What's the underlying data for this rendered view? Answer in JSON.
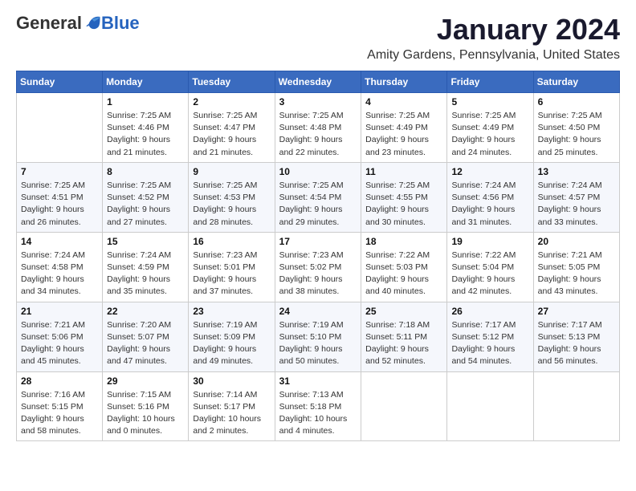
{
  "logo": {
    "general": "General",
    "blue": "Blue"
  },
  "header": {
    "month": "January 2024",
    "location": "Amity Gardens, Pennsylvania, United States"
  },
  "weekdays": [
    "Sunday",
    "Monday",
    "Tuesday",
    "Wednesday",
    "Thursday",
    "Friday",
    "Saturday"
  ],
  "weeks": [
    [
      {
        "day": "",
        "sunrise": "",
        "sunset": "",
        "daylight": ""
      },
      {
        "day": "1",
        "sunrise": "Sunrise: 7:25 AM",
        "sunset": "Sunset: 4:46 PM",
        "daylight": "Daylight: 9 hours and 21 minutes."
      },
      {
        "day": "2",
        "sunrise": "Sunrise: 7:25 AM",
        "sunset": "Sunset: 4:47 PM",
        "daylight": "Daylight: 9 hours and 21 minutes."
      },
      {
        "day": "3",
        "sunrise": "Sunrise: 7:25 AM",
        "sunset": "Sunset: 4:48 PM",
        "daylight": "Daylight: 9 hours and 22 minutes."
      },
      {
        "day": "4",
        "sunrise": "Sunrise: 7:25 AM",
        "sunset": "Sunset: 4:49 PM",
        "daylight": "Daylight: 9 hours and 23 minutes."
      },
      {
        "day": "5",
        "sunrise": "Sunrise: 7:25 AM",
        "sunset": "Sunset: 4:49 PM",
        "daylight": "Daylight: 9 hours and 24 minutes."
      },
      {
        "day": "6",
        "sunrise": "Sunrise: 7:25 AM",
        "sunset": "Sunset: 4:50 PM",
        "daylight": "Daylight: 9 hours and 25 minutes."
      }
    ],
    [
      {
        "day": "7",
        "sunrise": "Sunrise: 7:25 AM",
        "sunset": "Sunset: 4:51 PM",
        "daylight": "Daylight: 9 hours and 26 minutes."
      },
      {
        "day": "8",
        "sunrise": "Sunrise: 7:25 AM",
        "sunset": "Sunset: 4:52 PM",
        "daylight": "Daylight: 9 hours and 27 minutes."
      },
      {
        "day": "9",
        "sunrise": "Sunrise: 7:25 AM",
        "sunset": "Sunset: 4:53 PM",
        "daylight": "Daylight: 9 hours and 28 minutes."
      },
      {
        "day": "10",
        "sunrise": "Sunrise: 7:25 AM",
        "sunset": "Sunset: 4:54 PM",
        "daylight": "Daylight: 9 hours and 29 minutes."
      },
      {
        "day": "11",
        "sunrise": "Sunrise: 7:25 AM",
        "sunset": "Sunset: 4:55 PM",
        "daylight": "Daylight: 9 hours and 30 minutes."
      },
      {
        "day": "12",
        "sunrise": "Sunrise: 7:24 AM",
        "sunset": "Sunset: 4:56 PM",
        "daylight": "Daylight: 9 hours and 31 minutes."
      },
      {
        "day": "13",
        "sunrise": "Sunrise: 7:24 AM",
        "sunset": "Sunset: 4:57 PM",
        "daylight": "Daylight: 9 hours and 33 minutes."
      }
    ],
    [
      {
        "day": "14",
        "sunrise": "Sunrise: 7:24 AM",
        "sunset": "Sunset: 4:58 PM",
        "daylight": "Daylight: 9 hours and 34 minutes."
      },
      {
        "day": "15",
        "sunrise": "Sunrise: 7:24 AM",
        "sunset": "Sunset: 4:59 PM",
        "daylight": "Daylight: 9 hours and 35 minutes."
      },
      {
        "day": "16",
        "sunrise": "Sunrise: 7:23 AM",
        "sunset": "Sunset: 5:01 PM",
        "daylight": "Daylight: 9 hours and 37 minutes."
      },
      {
        "day": "17",
        "sunrise": "Sunrise: 7:23 AM",
        "sunset": "Sunset: 5:02 PM",
        "daylight": "Daylight: 9 hours and 38 minutes."
      },
      {
        "day": "18",
        "sunrise": "Sunrise: 7:22 AM",
        "sunset": "Sunset: 5:03 PM",
        "daylight": "Daylight: 9 hours and 40 minutes."
      },
      {
        "day": "19",
        "sunrise": "Sunrise: 7:22 AM",
        "sunset": "Sunset: 5:04 PM",
        "daylight": "Daylight: 9 hours and 42 minutes."
      },
      {
        "day": "20",
        "sunrise": "Sunrise: 7:21 AM",
        "sunset": "Sunset: 5:05 PM",
        "daylight": "Daylight: 9 hours and 43 minutes."
      }
    ],
    [
      {
        "day": "21",
        "sunrise": "Sunrise: 7:21 AM",
        "sunset": "Sunset: 5:06 PM",
        "daylight": "Daylight: 9 hours and 45 minutes."
      },
      {
        "day": "22",
        "sunrise": "Sunrise: 7:20 AM",
        "sunset": "Sunset: 5:07 PM",
        "daylight": "Daylight: 9 hours and 47 minutes."
      },
      {
        "day": "23",
        "sunrise": "Sunrise: 7:19 AM",
        "sunset": "Sunset: 5:09 PM",
        "daylight": "Daylight: 9 hours and 49 minutes."
      },
      {
        "day": "24",
        "sunrise": "Sunrise: 7:19 AM",
        "sunset": "Sunset: 5:10 PM",
        "daylight": "Daylight: 9 hours and 50 minutes."
      },
      {
        "day": "25",
        "sunrise": "Sunrise: 7:18 AM",
        "sunset": "Sunset: 5:11 PM",
        "daylight": "Daylight: 9 hours and 52 minutes."
      },
      {
        "day": "26",
        "sunrise": "Sunrise: 7:17 AM",
        "sunset": "Sunset: 5:12 PM",
        "daylight": "Daylight: 9 hours and 54 minutes."
      },
      {
        "day": "27",
        "sunrise": "Sunrise: 7:17 AM",
        "sunset": "Sunset: 5:13 PM",
        "daylight": "Daylight: 9 hours and 56 minutes."
      }
    ],
    [
      {
        "day": "28",
        "sunrise": "Sunrise: 7:16 AM",
        "sunset": "Sunset: 5:15 PM",
        "daylight": "Daylight: 9 hours and 58 minutes."
      },
      {
        "day": "29",
        "sunrise": "Sunrise: 7:15 AM",
        "sunset": "Sunset: 5:16 PM",
        "daylight": "Daylight: 10 hours and 0 minutes."
      },
      {
        "day": "30",
        "sunrise": "Sunrise: 7:14 AM",
        "sunset": "Sunset: 5:17 PM",
        "daylight": "Daylight: 10 hours and 2 minutes."
      },
      {
        "day": "31",
        "sunrise": "Sunrise: 7:13 AM",
        "sunset": "Sunset: 5:18 PM",
        "daylight": "Daylight: 10 hours and 4 minutes."
      },
      {
        "day": "",
        "sunrise": "",
        "sunset": "",
        "daylight": ""
      },
      {
        "day": "",
        "sunrise": "",
        "sunset": "",
        "daylight": ""
      },
      {
        "day": "",
        "sunrise": "",
        "sunset": "",
        "daylight": ""
      }
    ]
  ]
}
